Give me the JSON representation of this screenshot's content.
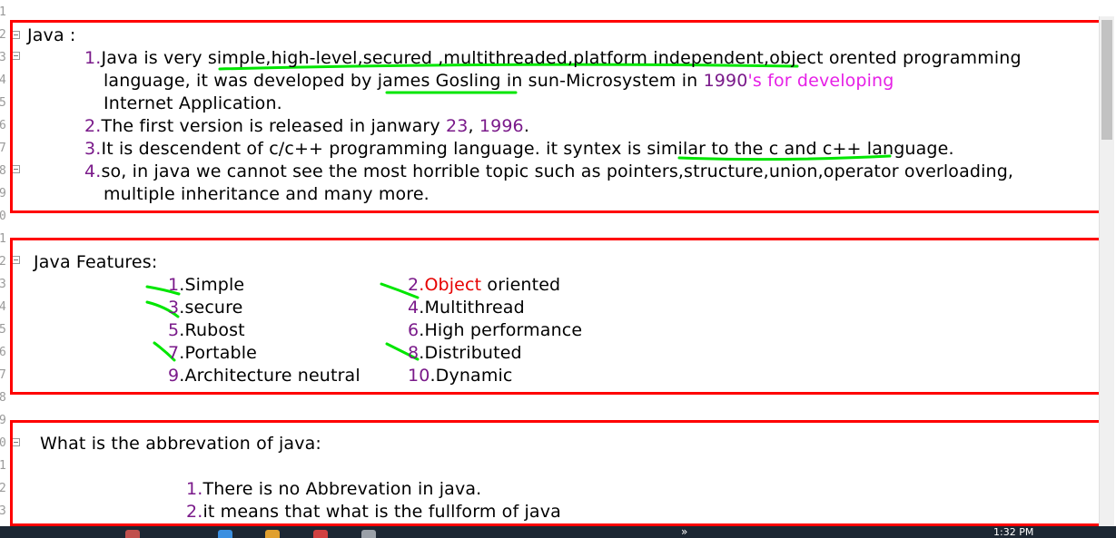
{
  "line_numbers": [
    "1",
    "2",
    "3",
    "4",
    "5",
    "6",
    "7",
    "8",
    "9",
    "0",
    "1",
    "2",
    "3",
    "4",
    "5",
    "6",
    "7",
    "8",
    "9",
    "0",
    "1",
    "2",
    "3"
  ],
  "section_java": {
    "heading": "Java :",
    "items": [
      {
        "num": "1.",
        "line1_a": "Java is very ",
        "line1_b": "simple,high-level,secured ,multithreaded,platform independent",
        "line1_c": ",object orented programming",
        "line2_a": "language, it was developed by ",
        "line2_b": "james Gosling",
        "line2_c": " in sun-Microsystem in ",
        "line2_d": "1990",
        "line2_e": "'s for developing",
        "line3": "Internet Application."
      },
      {
        "num": "2.",
        "text_a": "The first version is released in janwary ",
        "text_b": "23",
        "text_c": ", ",
        "text_d": "1996",
        "text_e": "."
      },
      {
        "num": "3.",
        "text_a": "It is descendent of c/c++ programming language. it syntex is ",
        "text_b": "similar to the c and c++",
        "text_c": " language."
      },
      {
        "num": "4.",
        "line1": "so, in java we cannot see the most horrible topic such as pointers,structure,union,operator overloading,",
        "line2": "multiple inheritance and many more."
      }
    ]
  },
  "section_features": {
    "heading": "Java Features:",
    "items": [
      {
        "num": "1",
        "text": ".Simple"
      },
      {
        "num": "2",
        "text_red": ".Object",
        "text": " oriented"
      },
      {
        "num": "3",
        "text": ".secure"
      },
      {
        "num": "4",
        "text": ".Multithread"
      },
      {
        "num": "5",
        "text": ".Rubost"
      },
      {
        "num": "6",
        "text": ".High performance"
      },
      {
        "num": "7",
        "text": ".Portable"
      },
      {
        "num": "8",
        "text": ".Distributed"
      },
      {
        "num": "9",
        "text": ".Architecture neutral"
      },
      {
        "num": "10",
        "text": ".Dynamic"
      }
    ]
  },
  "section_abbrev": {
    "heading": "What is the abbrevation of java:",
    "items": [
      {
        "num": "1.",
        "text": "There is no Abbrevation in java."
      },
      {
        "num": "2.",
        "text": "it means that what is the fullform of java"
      }
    ]
  },
  "taskbar": {
    "clock": "1:32 PM",
    "chevron": "»"
  },
  "colors": {
    "box_border": "#ff0000",
    "underline": "#00e600",
    "number": "#7a1a8a",
    "magenta": "#e620e6",
    "red_text": "#e60000"
  }
}
